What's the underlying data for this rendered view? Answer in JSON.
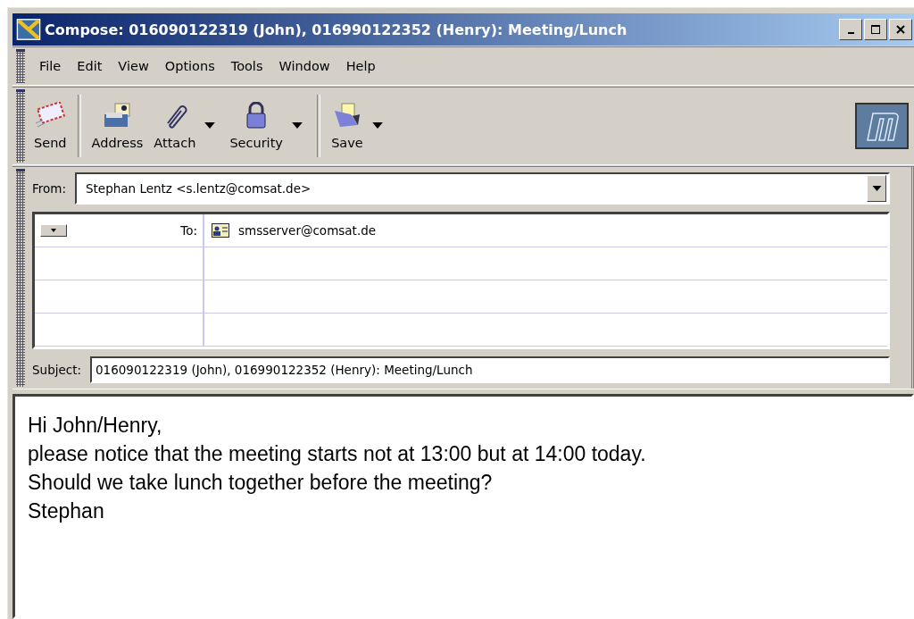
{
  "window": {
    "title": "Compose: 016090122319 (John), 016990122352 (Henry): Meeting/Lunch"
  },
  "menu": [
    "File",
    "Edit",
    "View",
    "Options",
    "Tools",
    "Window",
    "Help"
  ],
  "toolbar": [
    [
      {
        "label": "Send",
        "has_menu": false
      }
    ],
    [
      {
        "label": "Address",
        "has_menu": false
      },
      {
        "label": "Attach",
        "has_menu": true
      },
      {
        "label": "Security",
        "has_menu": true
      }
    ],
    [
      {
        "label": "Save",
        "has_menu": true
      }
    ]
  ],
  "from": {
    "label": "From:",
    "value": "Stephan Lentz <s.lentz@comsat.de>"
  },
  "recipients": [
    {
      "type": "To:",
      "address": "smsserver@comsat.de"
    }
  ],
  "subject": {
    "label": "Subject:",
    "value": "016090122319 (John), 016990122352 (Henry): Meeting/Lunch"
  },
  "body": [
    "Hi John/Henry,",
    "please notice that the meeting starts not at 13:00 but at 14:00 today.",
    "Should we take lunch together before the meeting?",
    "Stephan"
  ]
}
